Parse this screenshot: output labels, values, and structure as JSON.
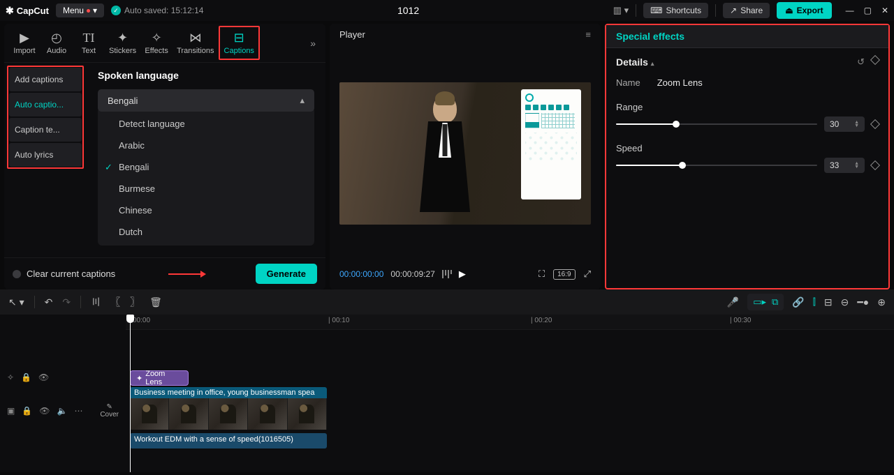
{
  "titlebar": {
    "app_name": "CapCut",
    "menu_label": "Menu",
    "autosave": "Auto saved: 15:12:14",
    "project_title": "1012",
    "shortcuts": "Shortcuts",
    "share": "Share",
    "export": "Export"
  },
  "media_tabs": {
    "import": "Import",
    "audio": "Audio",
    "text": "Text",
    "stickers": "Stickers",
    "effects": "Effects",
    "transitions": "Transitions",
    "captions": "Captions"
  },
  "caption_sidebar": {
    "add_captions": "Add captions",
    "auto_captions": "Auto captio...",
    "caption_templates": "Caption te...",
    "auto_lyrics": "Auto lyrics"
  },
  "spoken_lang": {
    "title": "Spoken language",
    "selected": "Bengali",
    "options": {
      "detect": "Detect language",
      "arabic": "Arabic",
      "bengali": "Bengali",
      "burmese": "Burmese",
      "chinese": "Chinese",
      "dutch": "Dutch"
    }
  },
  "left_footer": {
    "clear": "Clear current captions",
    "generate": "Generate"
  },
  "player": {
    "title": "Player",
    "current_time": "00:00:00:00",
    "duration": "00:00:09:27",
    "aspect": "16:9"
  },
  "effects_panel": {
    "header": "Special effects",
    "details": "Details",
    "name_label": "Name",
    "name_value": "Zoom Lens",
    "range_label": "Range",
    "range_value": "30",
    "speed_label": "Speed",
    "speed_value": "33"
  },
  "timeline": {
    "marks": {
      "m0": "00:00",
      "m10": "| 00:10",
      "m20": "| 00:20",
      "m30": "| 00:30"
    },
    "cover": "Cover",
    "fx_clip": "Zoom Lens",
    "video_clip": "Business meeting in office, young businessman spea",
    "audio_clip": "Workout EDM with a sense of speed(1016505)"
  }
}
